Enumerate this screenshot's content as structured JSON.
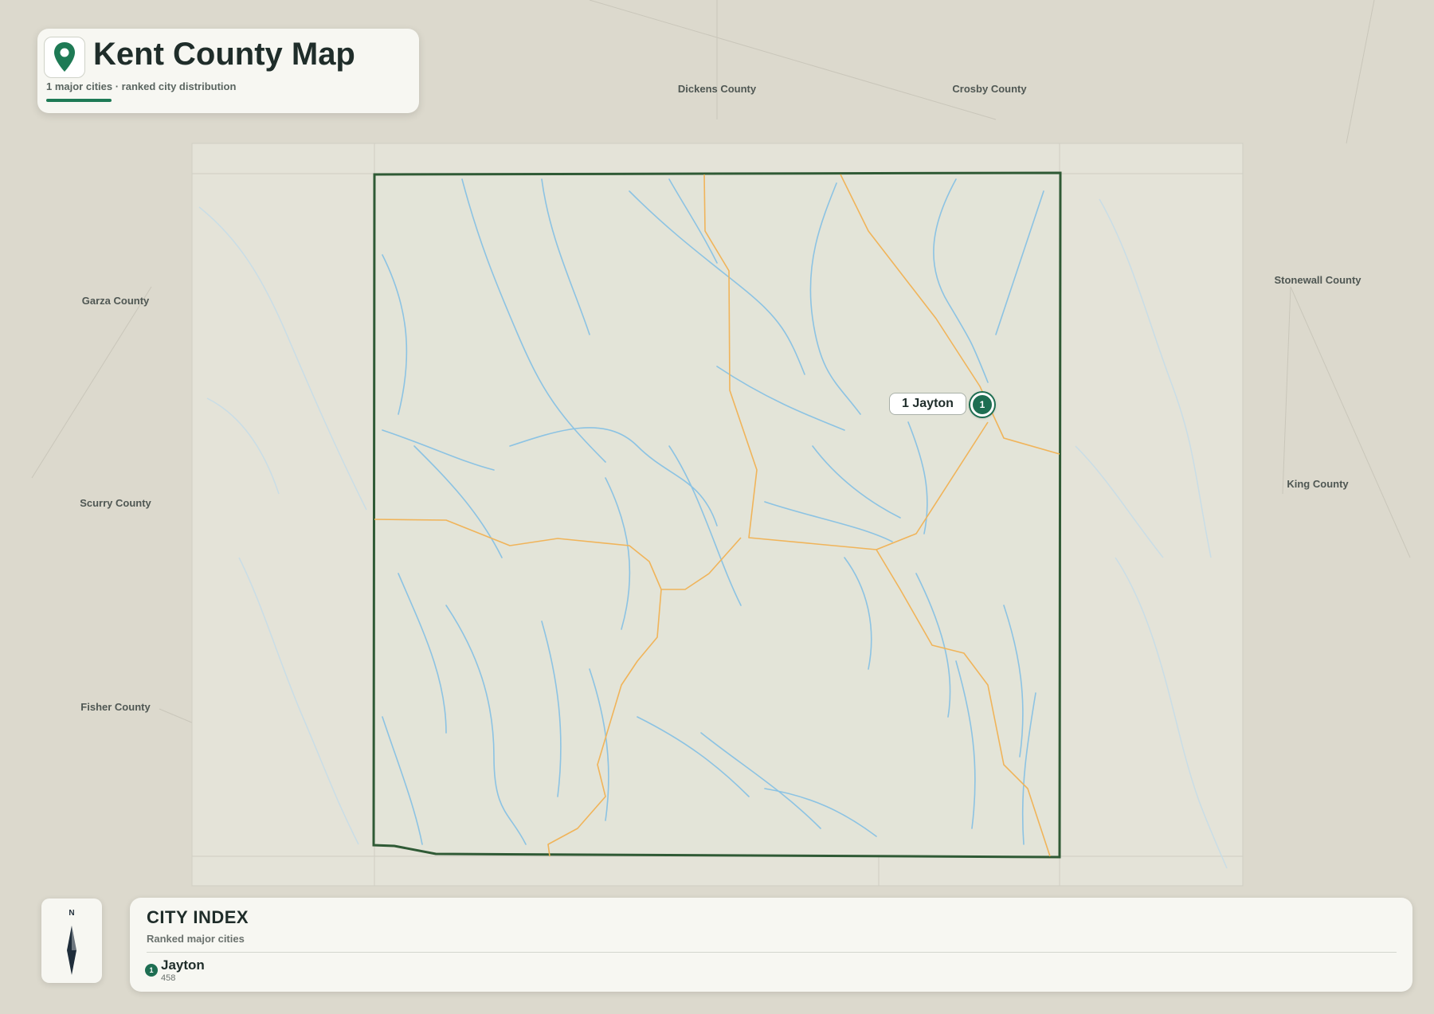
{
  "header": {
    "title": "Kent County Map",
    "subtitle": "1 major cities · ranked city distribution",
    "icon": "map-pin-icon"
  },
  "map": {
    "county": "Kent County",
    "neighbors": [
      "Dickens County",
      "Crosby County",
      "Garza County",
      "Stonewall County",
      "Scurry County",
      "King County",
      "Fisher County"
    ],
    "colors": {
      "county_fill": "#e3e4d8",
      "county_border": "#2f5a35",
      "rivers": "#8cc3e3",
      "roads": "#f0b45a",
      "marker": "#1e6e52"
    }
  },
  "cities": [
    {
      "rank": "1",
      "callout": "1 Jayton",
      "name": "Jayton",
      "population": "458"
    }
  ],
  "compass": {
    "north_label": "N",
    "icon": "compass-icon"
  },
  "city_index": {
    "title": "CITY INDEX",
    "subtitle": "Ranked major cities"
  }
}
